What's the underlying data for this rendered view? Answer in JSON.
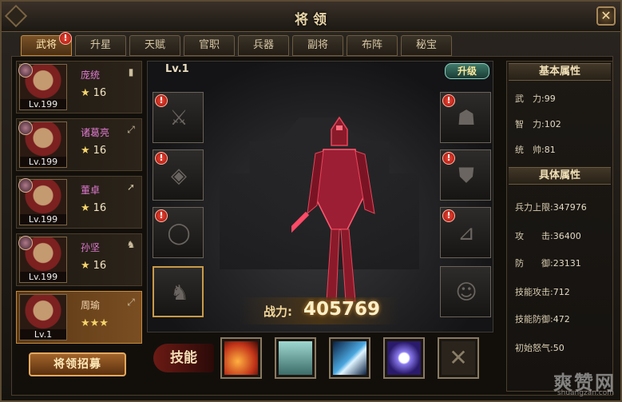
{
  "window": {
    "title": "将领",
    "close_label": "✕"
  },
  "tabs": [
    {
      "label": "武将",
      "active": true,
      "alert": true
    },
    {
      "label": "升星"
    },
    {
      "label": "天赋"
    },
    {
      "label": "官职"
    },
    {
      "label": "兵器"
    },
    {
      "label": "副将"
    },
    {
      "label": "布阵"
    },
    {
      "label": "秘宝"
    }
  ],
  "roster": [
    {
      "name": "庞统",
      "level": "Lv.199",
      "star_icon": "★",
      "stars": "16",
      "class_icon": "shield-icon",
      "selected": false
    },
    {
      "name": "诸葛亮",
      "level": "Lv.199",
      "star_icon": "★",
      "stars": "16",
      "class_icon": "bow-icon",
      "selected": false
    },
    {
      "name": "董卓",
      "level": "Lv.199",
      "star_icon": "★",
      "stars": "16",
      "class_icon": "spear-icon",
      "selected": false
    },
    {
      "name": "孙坚",
      "level": "Lv.199",
      "star_icon": "★",
      "stars": "16",
      "class_icon": "horse-icon",
      "selected": false
    },
    {
      "name": "周瑜",
      "level": "Lv.1",
      "star_icon": "★★★",
      "stars": "",
      "class_icon": "bow-icon",
      "selected": true
    }
  ],
  "recruit_button": "将领招募",
  "stage": {
    "level": "Lv.1",
    "upgrade_label": "升级",
    "power_label": "战力:",
    "power_value": "405769"
  },
  "slots_left": [
    {
      "icon": "sword-icon",
      "alert": true
    },
    {
      "icon": "amulet-icon",
      "alert": true
    },
    {
      "icon": "ring-icon",
      "alert": true
    },
    {
      "icon": "horse-icon",
      "alert": false,
      "equipped": true
    }
  ],
  "slots_right": [
    {
      "icon": "helmet-icon",
      "alert": true
    },
    {
      "icon": "armor-icon",
      "alert": true
    },
    {
      "icon": "boots-icon",
      "alert": true
    },
    {
      "icon": "portrait-icon",
      "alert": false
    }
  ],
  "skills": {
    "label": "技能",
    "items": [
      {
        "icon": "fire-meteor-icon",
        "color": "#c2341a"
      },
      {
        "icon": "boat-icon",
        "color": "#7fc0b8"
      },
      {
        "icon": "ice-blade-icon",
        "color": "#4aa8e0"
      },
      {
        "icon": "lightning-orb-icon",
        "color": "#6a5ae0"
      },
      {
        "icon": "crossed-swords-icon",
        "color": "#5a4e3e"
      }
    ]
  },
  "attributes": {
    "basic_header": "基本属性",
    "basic": [
      {
        "key": "武　力:",
        "value": "99"
      },
      {
        "key": "智　力:",
        "value": "102"
      },
      {
        "key": "统　帅:",
        "value": "81"
      }
    ],
    "detail_header": "具体属性",
    "detail": [
      {
        "key": "兵力上限:",
        "value": "347976"
      },
      {
        "key": "攻　　击:",
        "value": "36400"
      },
      {
        "key": "防　　御:",
        "value": "23131"
      },
      {
        "key": "技能攻击:",
        "value": "712"
      },
      {
        "key": "技能防御:",
        "value": "472"
      },
      {
        "key": "初始怒气:",
        "value": "50"
      }
    ]
  },
  "watermark": {
    "main": "爽赞网",
    "sub": "shuangzan.com"
  }
}
